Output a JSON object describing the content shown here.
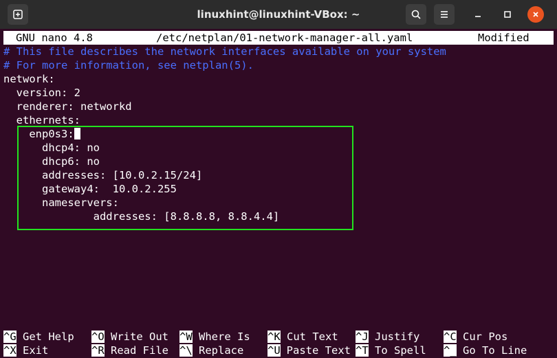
{
  "window": {
    "title": "linuxhint@linuxhint-VBox: ~"
  },
  "nano": {
    "version": "GNU nano 4.8",
    "filename": "/etc/netplan/01-network-manager-all.yaml",
    "status": "Modified"
  },
  "file_lines": [
    "# This file describes the network interfaces available on your system",
    "# For more information, see netplan(5).",
    "network:",
    "  version: 2",
    "  renderer: networkd",
    "  ethernets:",
    "    enp0s3:",
    "      dhcp4: no",
    "      dhcp6: no",
    "      addresses: [10.0.2.15/24]",
    "      gateway4:  10.0.2.255",
    "      nameservers:",
    "              addresses: [8.8.8.8, 8.8.4.4]"
  ],
  "shortcuts_row1": [
    {
      "key": "^G",
      "label": "Get Help"
    },
    {
      "key": "^O",
      "label": "Write Out"
    },
    {
      "key": "^W",
      "label": "Where Is"
    },
    {
      "key": "^K",
      "label": "Cut Text"
    },
    {
      "key": "^J",
      "label": "Justify"
    },
    {
      "key": "^C",
      "label": "Cur Pos"
    }
  ],
  "shortcuts_row2": [
    {
      "key": "^X",
      "label": "Exit"
    },
    {
      "key": "^R",
      "label": "Read File"
    },
    {
      "key": "^\\",
      "label": "Replace"
    },
    {
      "key": "^U",
      "label": "Paste Text"
    },
    {
      "key": "^T",
      "label": "To Spell"
    },
    {
      "key": "^_",
      "label": "Go To Line"
    }
  ],
  "colors": {
    "terminal_bg": "#300a24",
    "comment": "#4a6fff",
    "highlight_box": "#22e31e",
    "close_button": "#e95420"
  }
}
